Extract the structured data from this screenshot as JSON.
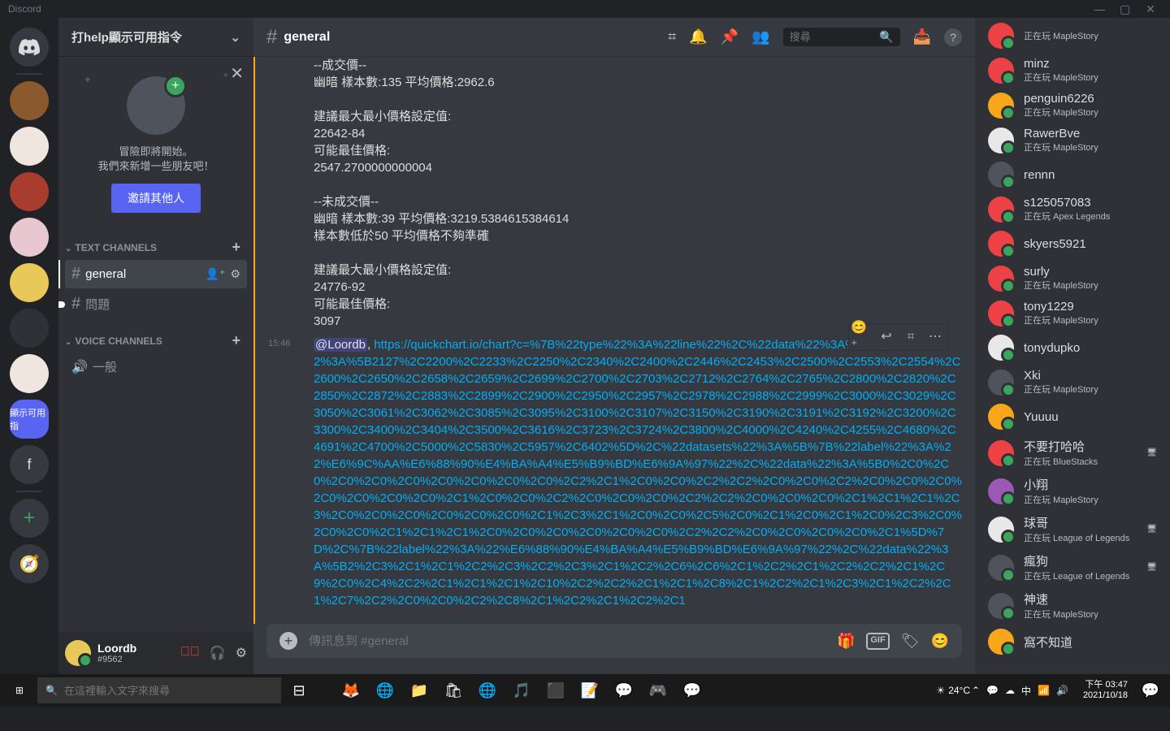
{
  "titlebar": {
    "brand": "Discord"
  },
  "sidebar": {
    "headerText": "打help顯示可用指令",
    "welcome": {
      "line": "冒險即將開始。\n我們來新增一些朋友吧！",
      "button": "邀請其他人"
    },
    "sections": {
      "text": "TEXT CHANNELS",
      "voice": "VOICE CHANNELS"
    },
    "channels": {
      "general": "general",
      "problem": "問題",
      "voice": "一般"
    }
  },
  "user": {
    "name": "Loordb",
    "tag": "#9562"
  },
  "chat": {
    "channel": "general",
    "searchPlaceholder": "搜尋",
    "inputPlaceholder": "傳訊息到 #general",
    "msg1": "--成交價--\n幽暗 樣本數:135 平均價格:2962.6\n\n建議最大最小價格設定值:\n22642-84\n可能最佳價格:\n2547.2700000000004\n\n--未成交價--\n幽暗 樣本數:39 平均價格:3219.5384615384614\n樣本數低於50 平均價格不夠準確\n\n建議最大最小價格設定值:\n24776-92\n可能最佳價格:\n3097",
    "timestamp": "15:46",
    "mention": "@Loordb",
    "linkText": "https://quickchart.io/chart?c=%7B%22type%22%3A%22line%22%2C%22data%22%3A%7B%22labels%22%3A%5B2127%2C2200%2C2233%2C2250%2C2340%2C2400%2C2446%2C2453%2C2500%2C2553%2C2554%2C2600%2C2650%2C2658%2C2659%2C2699%2C2700%2C2703%2C2712%2C2764%2C2765%2C2800%2C2820%2C2850%2C2872%2C2883%2C2899%2C2900%2C2950%2C2957%2C2978%2C2988%2C2999%2C3000%2C3029%2C3050%2C3061%2C3062%2C3085%2C3095%2C3100%2C3107%2C3150%2C3190%2C3191%2C3192%2C3200%2C3300%2C3400%2C3404%2C3500%2C3616%2C3723%2C3724%2C3800%2C4000%2C4240%2C4255%2C4680%2C4691%2C4700%2C5000%2C5830%2C5957%2C6402%5D%2C%22datasets%22%3A%5B%7B%22label%22%3A%22%E6%9C%AA%E6%88%90%E4%BA%A4%E5%B9%BD%E6%9A%97%22%2C%22data%22%3A%5B0%2C0%2C0%2C0%2C0%2C0%2C0%2C0%2C0%2C0%2C2%2C1%2C0%2C0%2C2%2C2%2C0%2C0%2C2%2C0%2C0%2C0%2C0%2C0%2C0%2C0%2C1%2C0%2C0%2C2%2C0%2C0%2C0%2C2%2C2%2C0%2C0%2C0%2C1%2C1%2C1%2C3%2C0%2C0%2C0%2C0%2C0%2C0%2C1%2C3%2C1%2C0%2C0%2C5%2C0%2C1%2C0%2C1%2C0%2C3%2C0%2C0%2C0%2C1%2C1%2C1%2C0%2C0%2C0%2C0%2C0%2C0%2C2%2C2%2C0%2C0%2C0%2C0%2C1%5D%7D%2C%7B%22label%22%3A%22%E6%88%90%E4%BA%A4%E5%B9%BD%E6%9A%97%22%2C%22data%22%3A%5B2%2C3%2C1%2C1%2C2%2C3%2C2%2C3%2C1%2C2%2C6%2C6%2C1%2C2%2C1%2C2%2C2%2C1%2C9%2C0%2C4%2C2%2C1%2C1%2C1%2C10%2C2%2C2%2C1%2C1%2C8%2C1%2C2%2C1%2C3%2C1%2C2%2C1%2C7%2C2%2C0%2C0%2C2%2C8%2C1%2C2%2C1%2C2%2C1"
  },
  "members": [
    {
      "name": "minz",
      "status": "正在玩 MapleStory",
      "c": "red"
    },
    {
      "name": "penguin6226",
      "status": "正在玩 MapleStory",
      "c": "yellow"
    },
    {
      "name": "RawerBve",
      "status": "正在玩 MapleStory",
      "c": "white"
    },
    {
      "name": "rennn",
      "status": "",
      "c": "dark"
    },
    {
      "name": "s125057083",
      "status": "正在玩 Apex Legends",
      "c": "red"
    },
    {
      "name": "skyers5921",
      "status": "",
      "c": "red"
    },
    {
      "name": "surly",
      "status": "正在玩 MapleStory",
      "c": "red"
    },
    {
      "name": "tony1229",
      "status": "正在玩 MapleStory",
      "c": "red"
    },
    {
      "name": "tonydupko",
      "status": "",
      "c": "white"
    },
    {
      "name": "Xki",
      "status": "正在玩 MapleStory",
      "c": "dark"
    },
    {
      "name": "Yuuuu",
      "status": "",
      "c": "yellow"
    },
    {
      "name": "不要打哈哈",
      "status": "正在玩 BlueStacks",
      "c": "red",
      "badge": "🖥"
    },
    {
      "name": "小翔",
      "status": "正在玩 MapleStory",
      "c": "purple"
    },
    {
      "name": "球哥",
      "status": "正在玩 League of Legends",
      "c": "white",
      "badge": "🖥"
    },
    {
      "name": "瘋狗",
      "status": "正在玩 League of Legends",
      "c": "dark",
      "badge": "🖥"
    },
    {
      "name": "神速",
      "status": "正在玩 MapleStory",
      "c": "dark"
    },
    {
      "name": "窩不知道",
      "status": "",
      "c": "yellow"
    }
  ],
  "membersPartial": {
    "status": "正在玩 MapleStory"
  },
  "taskbar": {
    "searchPlaceholder": "在這裡輸入文字來搜尋",
    "temp": "24°C",
    "time": "下午 03:47",
    "date": "2021/10/18",
    "ime": "中"
  }
}
